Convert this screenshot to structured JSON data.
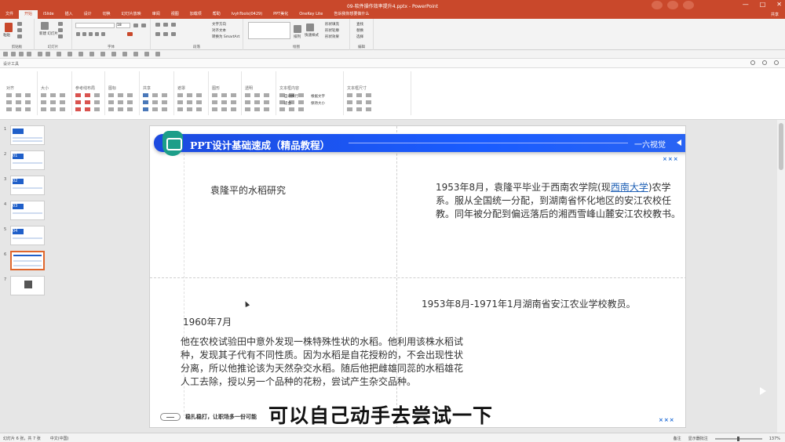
{
  "window": {
    "doc_title": "09-软件操作效率提升4.pptx  -  PowerPoint",
    "controls": [
      "—",
      "□",
      "✕"
    ]
  },
  "tabs": [
    "文件",
    "开始",
    "iSlide",
    "插入",
    "设计",
    "切换",
    "幻灯片放映",
    "审阅",
    "视图",
    "加载项",
    "帮助",
    "lvyhTools(0429)",
    "PPT美化",
    "OneKey Lite",
    "告诉我你想要做什么"
  ],
  "active_tab": "开始",
  "share_label": "共享",
  "ribbon_groups": [
    "剪贴板",
    "幻灯片",
    "字体",
    "段落",
    "绘图",
    "编辑"
  ],
  "ribbon_buttons": {
    "paste": "粘贴",
    "new_slide": "新建\n幻灯片",
    "font_size": "18",
    "find": "查找",
    "replace": "替换",
    "select": "选择",
    "arrange": "排列",
    "quick_styles": "快速样式",
    "text_direction": "文字方向",
    "align_text": "对齐文本",
    "smartart": "转换为 SmartArt",
    "shape_fill": "形状填充",
    "shape_outline": "形状轮廓",
    "shape_effects": "形状效果"
  },
  "tool_pane": {
    "label": "设计工具"
  },
  "ribbon2_groups": [
    "对齐",
    "大小",
    "参考线布局",
    "图标",
    "共享",
    "遮罩",
    "图形",
    "透明",
    "文本框内容",
    "文本框尺寸"
  ],
  "ribbon2_opts": {
    "auto_wrap": "自动换行",
    "fit": "适合",
    "fit_size": "根据文字",
    "keep": "保持大小"
  },
  "thumbnails": [
    {
      "num": "1"
    },
    {
      "num": "2",
      "badge": "01"
    },
    {
      "num": "3",
      "badge": "02"
    },
    {
      "num": "4",
      "badge": "03"
    },
    {
      "num": "5",
      "badge": "04"
    },
    {
      "num": "6"
    },
    {
      "num": "7"
    }
  ],
  "slide": {
    "banner_title": "PPT设计基础速成（精品教程）",
    "banner_brand": "一六视觉",
    "xxx": "×××",
    "text1": "袁隆平的水稻研究",
    "text2_a": "1953年8月，袁隆平毕业于西南农学院(现",
    "text2_link": "西南大学",
    "text2_b": ")农学系。服从全国统一分配，到湖南省怀化地区的安江农校任教。同年被分配到偏远落后的湘西雪峰山麓安江农校教书。",
    "text3": "1953年8月-1971年1月湖南省安江农业学校教员。",
    "text4": "1960年7月",
    "text5": "他在农校试验田中意外发现一株特殊性状的水稻。他利用该株水稻试种，发现其子代有不同性质。因为水稻是自花授粉的，不会出现性状分离，所以他推论该为天然杂交水稻。随后他把雌雄同蕊的水稻雄花人工去除，授以另一个品种的花粉，尝试产生杂交品种。",
    "footer": "稳扎稳打，让职场多一份可能"
  },
  "subtitle": "可以自己动手去尝试一下",
  "status": {
    "slide": "幻灯片 6 张，共 7 张",
    "lang": "中文(中国)",
    "notes": "备注",
    "comments": "显示器批注",
    "zoom": "137%"
  }
}
